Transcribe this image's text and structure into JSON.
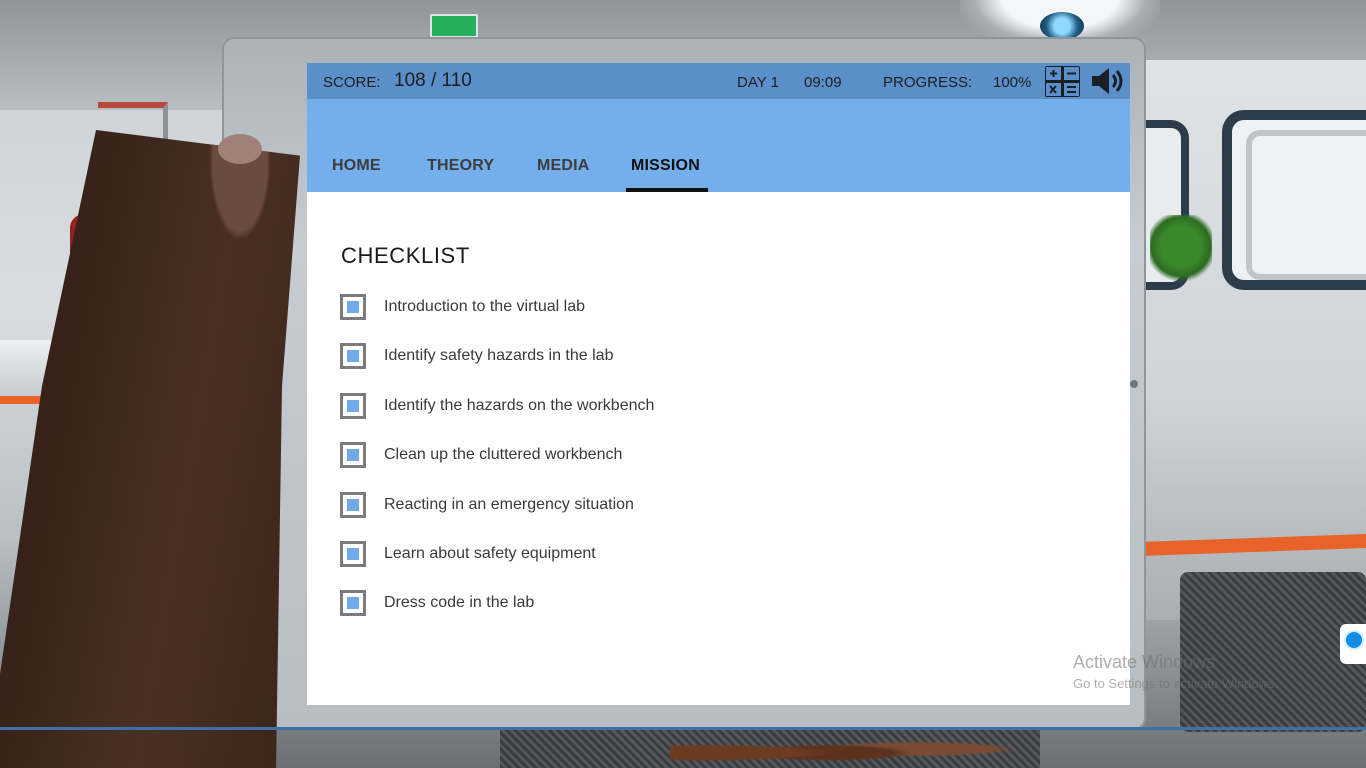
{
  "app": {
    "score_label": "SCORE:",
    "score_value": "108 / 110",
    "day": "DAY 1",
    "time": "09:09",
    "progress_label": "PROGRESS:",
    "progress_value": "100%",
    "progress_fraction": 1.0
  },
  "tabs": [
    {
      "label": "HOME",
      "active": false
    },
    {
      "label": "THEORY",
      "active": false
    },
    {
      "label": "MEDIA",
      "active": false
    },
    {
      "label": "MISSION",
      "active": true
    }
  ],
  "checklist": {
    "title": "CHECKLIST",
    "items": [
      {
        "label": "Introduction to the virtual lab",
        "checked": true
      },
      {
        "label": "Identify safety hazards in the lab",
        "checked": true
      },
      {
        "label": "Identify the hazards on the workbench",
        "checked": true
      },
      {
        "label": "Clean up the cluttered workbench",
        "checked": true
      },
      {
        "label": "Reacting in an emergency situation",
        "checked": true
      },
      {
        "label": "Learn about safety equipment",
        "checked": true
      },
      {
        "label": "Dress code in the lab",
        "checked": true
      }
    ]
  },
  "icons": {
    "calculator": "calculator-icon",
    "sound": "speaker-icon"
  },
  "watermark": {
    "title": "Activate Windows",
    "subtitle": "Go to Settings to activate Windows."
  },
  "colors": {
    "hud_bar": "#5b8fc9",
    "nav_bar": "#74aeeb",
    "check_fill": "#71aaeb",
    "lab_accent_orange": "#e8632a"
  }
}
